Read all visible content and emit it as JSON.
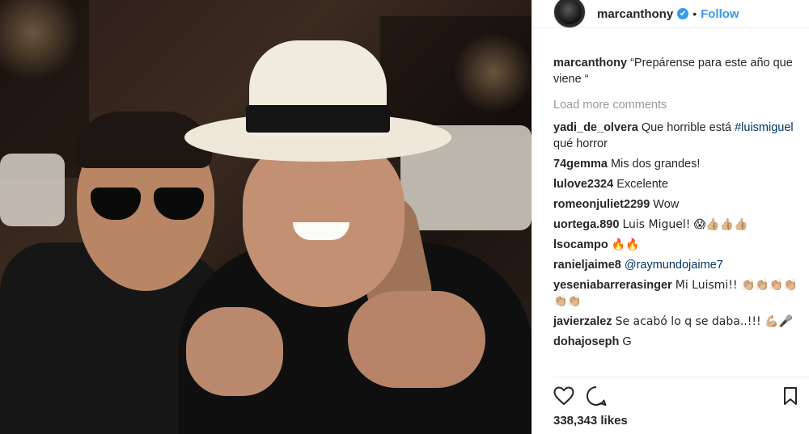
{
  "post": {
    "username": "marcanthony",
    "follow_label": "Follow",
    "separator": "•",
    "verified_symbol": "✔"
  },
  "caption": {
    "username": "marcanthony",
    "text": "“Prepárense para este año que viene “"
  },
  "load_more_label": "Load more comments",
  "comments": [
    {
      "user": "yadi_de_olvera",
      "pre": "Que horrible está",
      "tag": "#luismiguel",
      "post": "qué horror"
    },
    {
      "user": "74gemma",
      "text": "Mis dos grandes!"
    },
    {
      "user": "lulove2324",
      "text": "Excelente"
    },
    {
      "user": "romeonjuliet2299",
      "text": "Wow"
    },
    {
      "user": "uortega.890",
      "text": "Luis Miguel! 😱👍🏼👍🏼👍🏼"
    },
    {
      "user": "lsocampo",
      "text": "🔥🔥"
    },
    {
      "user": "ranieljaime8",
      "tag": "@raymundojaime7"
    },
    {
      "user": "yeseniabarrerasinger",
      "text": "Mi Luismi!! 👏🏼👏🏼👏🏼👏🏼👏🏼👏🏼"
    },
    {
      "user": "javierzalez",
      "text": "Se acabó lo q se daba..!!! 💪🏼🎤"
    },
    {
      "user": "dohajoseph",
      "text": "G"
    }
  ],
  "likes_text": "338,343 likes",
  "icons": {
    "like": "heart-icon",
    "comment": "comment-icon",
    "save": "bookmark-icon"
  }
}
